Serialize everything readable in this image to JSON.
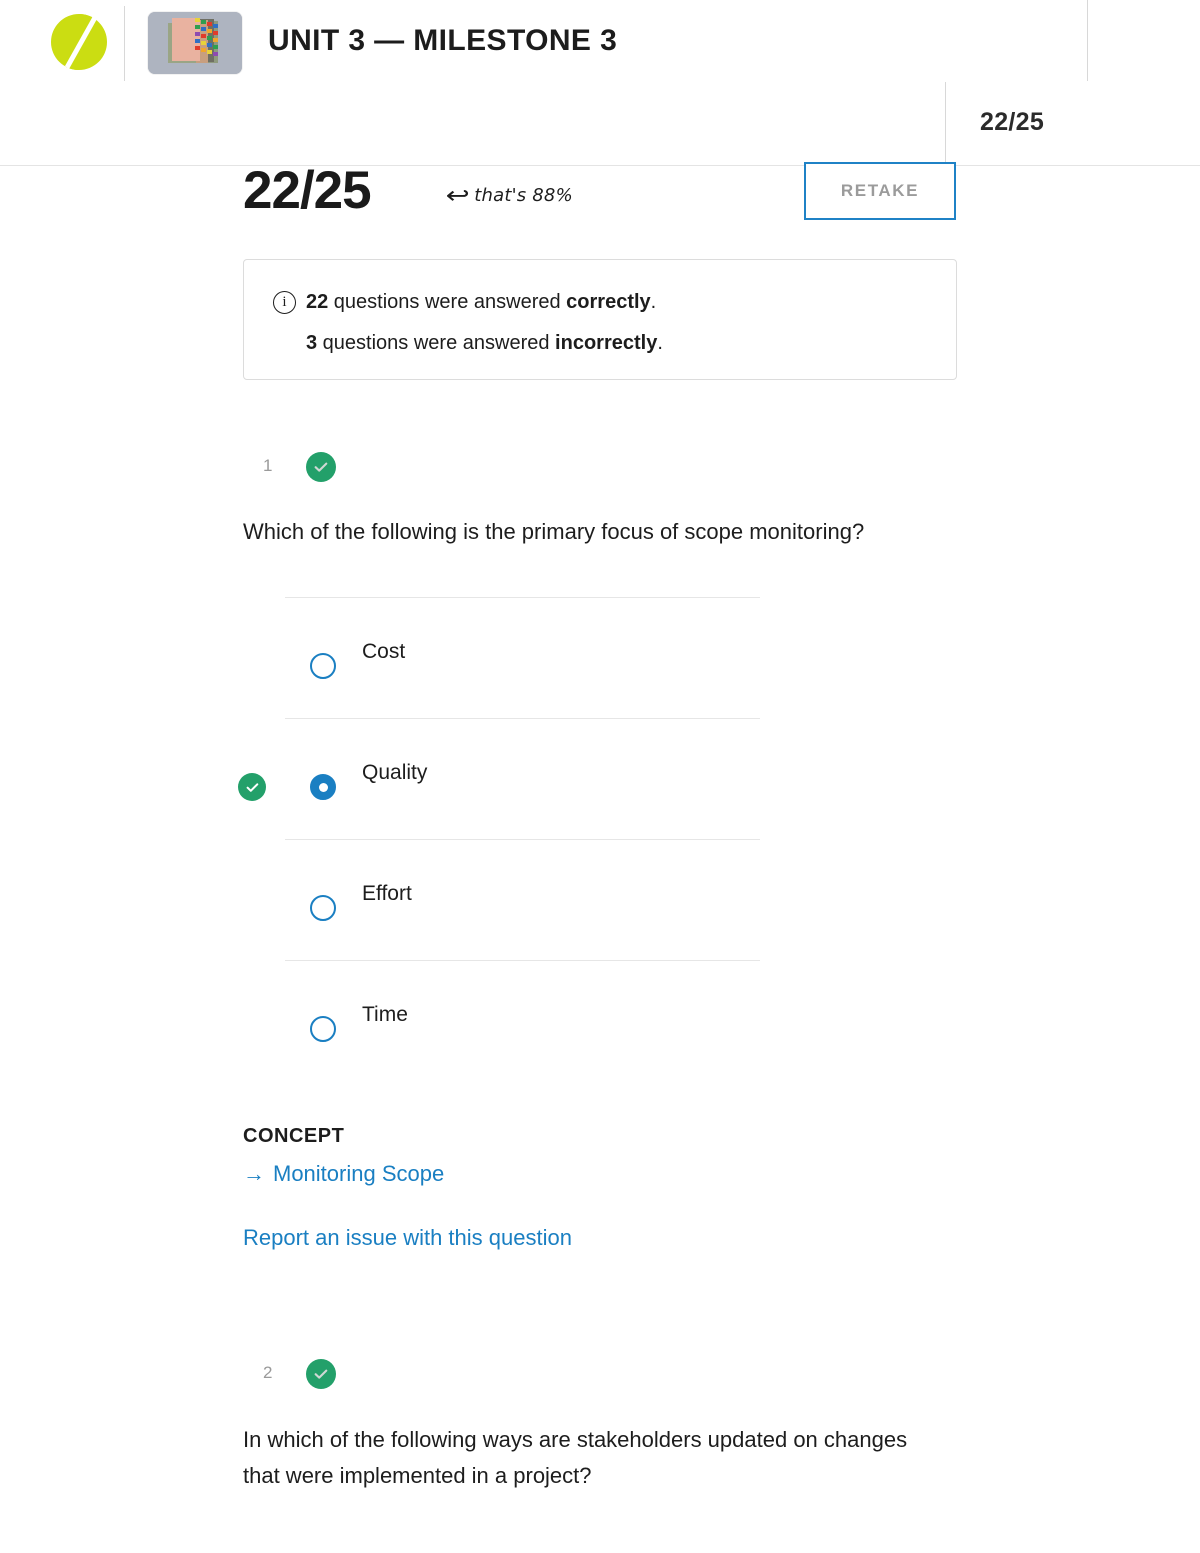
{
  "header": {
    "logo_icon": "sophia-leaf-logo",
    "thumbnail_icon": "course-notebooks-thumbnail",
    "unit_title": "UNIT 3 — MILESTONE 3",
    "score_compact": "22/25"
  },
  "score_row": {
    "score": "22/25",
    "arrow_icon": "curved-left-arrow",
    "percent_note": "that's 88%",
    "retake_label": "RETAKE",
    "accent_blue": "#1f82c6"
  },
  "summary_box": {
    "info_icon": "info-circle-icon",
    "correct_count": "22",
    "correct_line_rest": " questions were answered ",
    "correct_word": "correctly",
    "incorrect_count": "3",
    "incorrect_line_rest": " questions were answered ",
    "incorrect_word": "incorrectly",
    "period": "."
  },
  "questions": [
    {
      "number": "1",
      "status_icon": "check-circle-icon",
      "status_color": "#23a06a",
      "text": "Which of the following is the primary focus of scope monitoring?",
      "options": [
        {
          "label": "Cost",
          "selected": false,
          "correct": false
        },
        {
          "label": "Quality",
          "selected": true,
          "correct": true
        },
        {
          "label": "Effort",
          "selected": false,
          "correct": false
        },
        {
          "label": "Time",
          "selected": false,
          "correct": false
        }
      ],
      "concept_heading": "CONCEPT",
      "concept_arrow": "→",
      "concept_link": "Monitoring Scope",
      "report_link": "Report an issue with this question"
    },
    {
      "number": "2",
      "status_icon": "check-circle-icon",
      "status_color": "#23a06a",
      "text": "In which of the following ways are stakeholders updated on changes that were implemented in a project?"
    }
  ]
}
